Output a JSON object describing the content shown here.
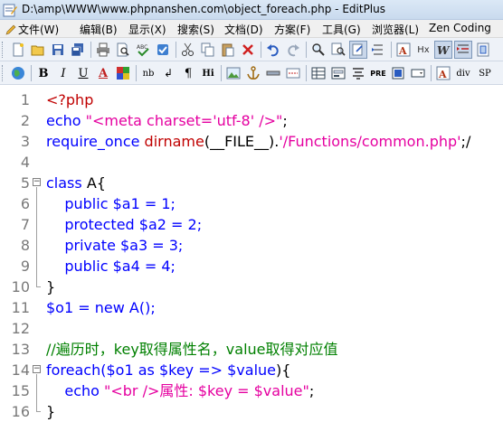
{
  "window": {
    "title": "D:\\amp\\WWW\\www.phpnanshen.com\\object_foreach.php - EditPlus"
  },
  "menu": [
    {
      "label": "文件(W)",
      "icon": "pencil-icon"
    },
    {
      "label": "编辑(B)"
    },
    {
      "label": "显示(X)"
    },
    {
      "label": "搜索(S)"
    },
    {
      "label": "文档(D)"
    },
    {
      "label": "方案(F)"
    },
    {
      "label": "工具(G)"
    },
    {
      "label": "浏览器(L)"
    },
    {
      "label": "Zen Coding"
    }
  ],
  "toolbar1_icons": [
    "new-file-icon",
    "open-folder-icon",
    "save-icon",
    "save-all-icon",
    "print-icon",
    "print-preview-icon",
    "spellcheck-icon",
    "check-icon",
    "cut-icon",
    "copy-icon",
    "paste-icon",
    "delete-icon",
    "undo-icon",
    "redo-icon",
    "find-icon",
    "replace-icon",
    "find-in-files-icon",
    "goto-icon",
    "font-size-icon",
    "hex-icon",
    "word-wrap-icon",
    "line-numbers-icon",
    "column-selection-icon"
  ],
  "toolbar2": {
    "buttons": [
      "B",
      "I",
      "U",
      "A",
      "nb",
      "¶",
      "Hi",
      "PRE",
      "div",
      "SP"
    ],
    "icons": [
      "browser-globe-icon",
      "color-icon",
      "image-icon",
      "anchor-icon",
      "hr-icon",
      "comment-icon",
      "table-icon",
      "form-icon",
      "list-icon"
    ]
  },
  "editor": {
    "lines": [
      {
        "n": "1",
        "segs": [
          [
            "<?php",
            "red"
          ]
        ]
      },
      {
        "n": "2",
        "segs": [
          [
            "echo ",
            "blue"
          ],
          [
            "\"<meta charset='utf-8' />\"",
            "pink"
          ],
          [
            ";",
            "black"
          ]
        ]
      },
      {
        "n": "3",
        "segs": [
          [
            "require_once ",
            "blue"
          ],
          [
            "dirname",
            "red"
          ],
          [
            "(__FILE__).",
            "black"
          ],
          [
            "'/Functions/common.php'",
            "pink"
          ],
          [
            ";/",
            "black"
          ]
        ]
      },
      {
        "n": "4",
        "segs": []
      },
      {
        "n": "5",
        "fold": "⊟",
        "segs": [
          [
            "class ",
            "blue"
          ],
          [
            "A{",
            "black"
          ]
        ]
      },
      {
        "n": "6",
        "segs": [
          [
            "    public ",
            "blue"
          ],
          [
            "$a1",
            "blue"
          ],
          [
            " = 1;",
            "blue"
          ]
        ]
      },
      {
        "n": "7",
        "segs": [
          [
            "    protected ",
            "blue"
          ],
          [
            "$a2",
            "blue"
          ],
          [
            " = 2;",
            "blue"
          ]
        ]
      },
      {
        "n": "8",
        "segs": [
          [
            "    private ",
            "blue"
          ],
          [
            "$a3",
            "blue"
          ],
          [
            " = 3;",
            "blue"
          ]
        ]
      },
      {
        "n": "9",
        "segs": [
          [
            "    public ",
            "blue"
          ],
          [
            "$a4",
            "blue"
          ],
          [
            " = 4;",
            "blue"
          ]
        ]
      },
      {
        "n": "10",
        "segs": [
          [
            "}",
            "black"
          ]
        ]
      },
      {
        "n": "11",
        "segs": [
          [
            "$o1",
            "blue"
          ],
          [
            " = new A();",
            "blue"
          ]
        ]
      },
      {
        "n": "12",
        "segs": []
      },
      {
        "n": "13",
        "segs": [
          [
            "//遍历时，key取得属性名，value取得对应值",
            "green"
          ]
        ]
      },
      {
        "n": "14",
        "fold": "⊟",
        "segs": [
          [
            "foreach(",
            "blue"
          ],
          [
            "$o1",
            "blue"
          ],
          [
            " as ",
            "blue"
          ],
          [
            "$key",
            "blue"
          ],
          [
            " => ",
            "blue"
          ],
          [
            "$value",
            "blue"
          ],
          [
            "){",
            "black"
          ]
        ]
      },
      {
        "n": "15",
        "segs": [
          [
            "    echo ",
            "blue"
          ],
          [
            "\"<br />属性: $key = $value\"",
            "pink"
          ],
          [
            ";",
            "black"
          ]
        ]
      },
      {
        "n": "16",
        "segs": [
          [
            "}",
            "black"
          ]
        ]
      }
    ]
  },
  "colors": {
    "keyword": "#0000ff",
    "string": "#e500a0",
    "function": "#c00000",
    "comment": "#008000",
    "line_number": "#7a7a7a"
  }
}
